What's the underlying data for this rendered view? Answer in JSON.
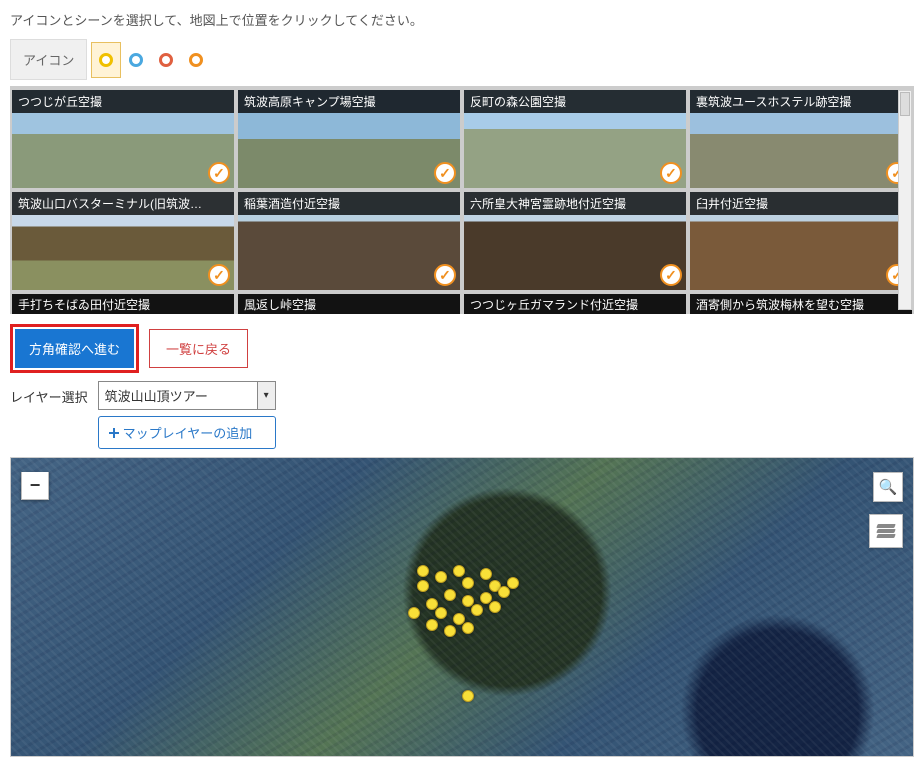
{
  "instruction": "アイコンとシーンを選択して、地図上で位置をクリックしてください。",
  "icon_label": "アイコン",
  "icon_colors": [
    "yellow",
    "blue",
    "red",
    "orange"
  ],
  "selected_color_index": 0,
  "scenes_row1": [
    {
      "title": "つつじが丘空撮",
      "bg": "bg1"
    },
    {
      "title": "筑波高原キャンプ場空撮",
      "bg": "bg2"
    },
    {
      "title": "反町の森公園空撮",
      "bg": "bg3"
    },
    {
      "title": "裏筑波ユースホステル跡空撮",
      "bg": "bg4"
    }
  ],
  "scenes_row2": [
    {
      "title": "筑波山口バスターミナル(旧筑波…",
      "bg": "bg5"
    },
    {
      "title": "稲葉酒造付近空撮",
      "bg": "bg6"
    },
    {
      "title": "六所皇大神宮霊跡地付近空撮",
      "bg": "bg7"
    },
    {
      "title": "臼井付近空撮",
      "bg": "bg8"
    }
  ],
  "scenes_row3": [
    {
      "title": "手打ちそばゐ田付近空撮"
    },
    {
      "title": "風返し峠空撮"
    },
    {
      "title": "つつじヶ丘ガマランド付近空撮"
    },
    {
      "title": "酒寄側から筑波梅林を望む空撮"
    }
  ],
  "buttons": {
    "proceed": "方角確認へ進む",
    "back": "一覧に戻る",
    "add_layer": "マップレイヤーの追加"
  },
  "layer_label": "レイヤー選択",
  "layer_selected": "筑波山山頂ツアー",
  "map_markers": [
    {
      "x": 47,
      "y": 38
    },
    {
      "x": 49,
      "y": 36
    },
    {
      "x": 50,
      "y": 40
    },
    {
      "x": 52,
      "y": 37
    },
    {
      "x": 53,
      "y": 41
    },
    {
      "x": 48,
      "y": 44
    },
    {
      "x": 46,
      "y": 47
    },
    {
      "x": 50,
      "y": 46
    },
    {
      "x": 52,
      "y": 45
    },
    {
      "x": 54,
      "y": 43
    },
    {
      "x": 45,
      "y": 41
    },
    {
      "x": 47,
      "y": 50
    },
    {
      "x": 49,
      "y": 52
    },
    {
      "x": 51,
      "y": 49
    },
    {
      "x": 53,
      "y": 48
    },
    {
      "x": 46,
      "y": 54
    },
    {
      "x": 48,
      "y": 56
    },
    {
      "x": 50,
      "y": 55
    },
    {
      "x": 44,
      "y": 50
    },
    {
      "x": 45,
      "y": 36
    },
    {
      "x": 55,
      "y": 40
    },
    {
      "x": 50,
      "y": 78
    }
  ]
}
